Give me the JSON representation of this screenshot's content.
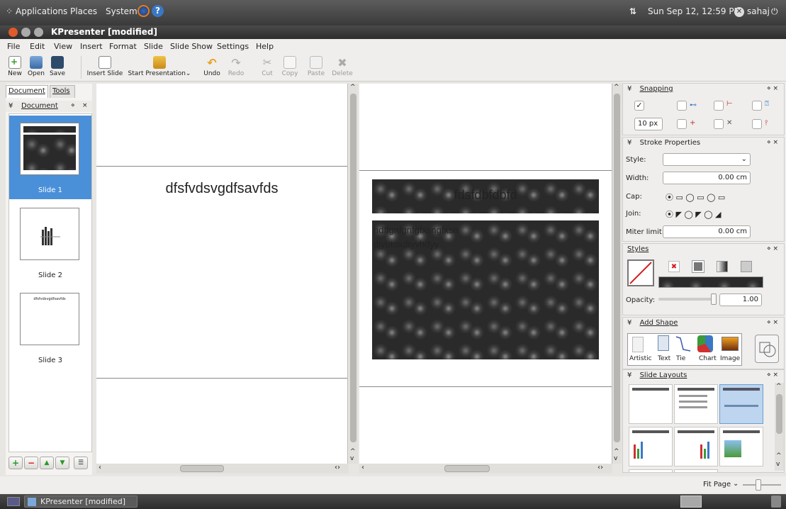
{
  "topbar": {
    "menus": [
      "Applications",
      "Places",
      "System"
    ],
    "datetime": "Sun Sep 12, 12:59 PM",
    "user": "sahaj"
  },
  "window": {
    "title": "KPresenter [modified]"
  },
  "menubar": [
    "File",
    "Edit",
    "View",
    "Insert",
    "Format",
    "Slide",
    "Slide Show",
    "Settings",
    "Help"
  ],
  "toolbar": {
    "new": "New",
    "open": "Open",
    "save": "Save",
    "insert_slide": "Insert Slide",
    "start_presentation": "Start Presentation",
    "undo": "Undo",
    "redo": "Redo",
    "cut": "Cut",
    "copy": "Copy",
    "paste": "Paste",
    "delete": "Delete"
  },
  "left_panel": {
    "tabs": [
      "Document",
      "Tools"
    ],
    "dock_title": "Document",
    "slides": [
      {
        "label": "Slide 1"
      },
      {
        "label": "Slide 2"
      },
      {
        "label": "Slide 3",
        "thumb_text": "dfsfvdsvgdfsavfds"
      }
    ]
  },
  "canvas1": {
    "title_text": "dfsfvdsvgdfsavfds"
  },
  "canvas2": {
    "title_text": "fdsfdbfdbfd",
    "body_line1": "hdffgnfgnfgfxsngfxsn",
    "body_line2": "djyutoxdtyvhdyy"
  },
  "snapping": {
    "title": "Snapping",
    "distance": "10 px"
  },
  "stroke": {
    "title": "Stroke Properties",
    "style_label": "Style:",
    "width_label": "Width:",
    "width_value": "0.00 cm",
    "cap_label": "Cap:",
    "join_label": "Join:",
    "miter_label": "Miter limit:",
    "miter_value": "0.00 cm"
  },
  "styles": {
    "title": "Styles",
    "opacity_label": "Opacity:",
    "opacity_value": "1.00",
    "opacity_level": 1.0
  },
  "add_shape": {
    "title": "Add Shape",
    "items": [
      "Artistic",
      "Text",
      "Tie",
      "Chart",
      "Image"
    ]
  },
  "slide_layouts": {
    "title": "Slide Layouts"
  },
  "statusbar": {
    "zoom": "Fit Page"
  },
  "taskbar": {
    "item": "KPresenter [modified]"
  }
}
